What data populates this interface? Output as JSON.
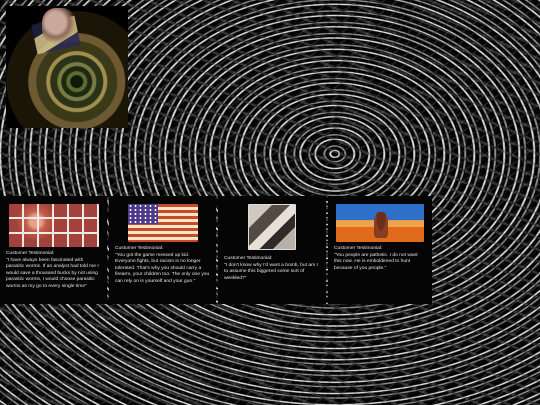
{
  "hero": {
    "image": "hypnotic-eye-artwork",
    "overlay_text": "▉ ▀ ▌\n█ ▐ ▊\n▄ █ ▌"
  },
  "cards": [
    {
      "image": "spam-slices-photo",
      "label": "Customer Testimonial:",
      "text": "\"I have always been fascinated with parasitic worms. If an analyst had told me I would save a thousand bucks by not using parasitic worms, I would choose parasitic worms as my go to every single time\""
    },
    {
      "image": "american-flag",
      "label": "Customer Testimonial:",
      "text": "\"You got the game messed up kid. Everyone fights, but racism is no longer tolerated. That's why you should carry a firearm, your children too. The only one you can rely on is yourself and your gun.\""
    },
    {
      "image": "bomb-scene-photo",
      "label": "Customer Testimonial:",
      "text": "\"I don't know why I'd want a bomb, but am I to assume this biggered some sort of weekled?\""
    },
    {
      "image": "desert-person-photo",
      "label": "Customer Testimonial:",
      "text": "\"You people are pathetic. I do not want this now. He is emboldened to hunt because of you people.\""
    }
  ],
  "colors": {
    "card_bg": "#050505",
    "text": "#e6e6e6"
  }
}
